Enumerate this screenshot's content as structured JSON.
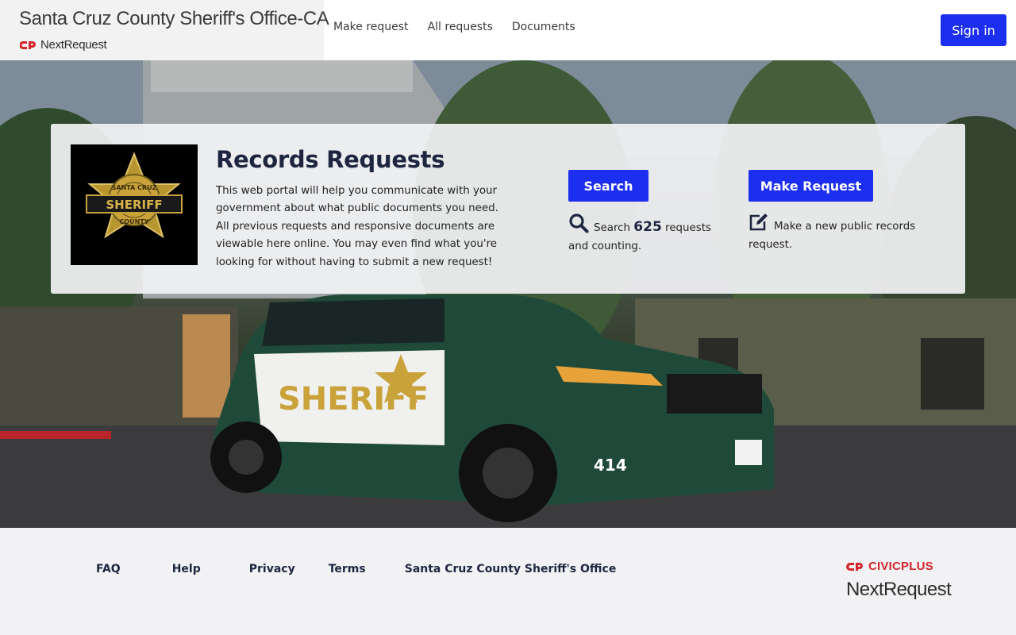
{
  "header": {
    "site_title": "Santa Cruz County Sheriff's Office-CA",
    "logo_text": "NextRequest",
    "nav": [
      {
        "label": "Make request"
      },
      {
        "label": "All requests"
      },
      {
        "label": "Documents"
      }
    ],
    "sign_in_label": "Sign in"
  },
  "hero": {
    "badge": {
      "top_text": "SANTA CRUZ",
      "center_text": "SHERIFF",
      "bottom_text": "COUNTY"
    },
    "title": "Records Requests",
    "description": "This web portal will help you communicate with your government about what public documents you need. All previous requests and responsive documents are viewable here online. You may even find what you're looking for without having to submit a new request!",
    "search": {
      "button_label": "Search",
      "stat_prefix": "Search",
      "count": "625",
      "stat_suffix": "requests and counting.",
      "icon": "search-icon"
    },
    "make_request": {
      "button_label": "Make Request",
      "stat_text": "Make a new public records request.",
      "icon": "edit-icon"
    },
    "photo": {
      "vehicle_text": "SHERIFF",
      "unit_number": "414"
    }
  },
  "footer": {
    "links": [
      {
        "label": "FAQ"
      },
      {
        "label": "Help"
      },
      {
        "label": "Privacy"
      },
      {
        "label": "Terms"
      },
      {
        "label": "Santa Cruz County Sheriff's Office"
      }
    ],
    "civicplus_label": "CIVICPLUS",
    "nextrequest_label": "NextRequest"
  },
  "colors": {
    "primary_button": "#1c2ff0",
    "title_navy": "#1d2540",
    "brand_red": "#d4262d",
    "badge_gold": "#c9a23a"
  }
}
